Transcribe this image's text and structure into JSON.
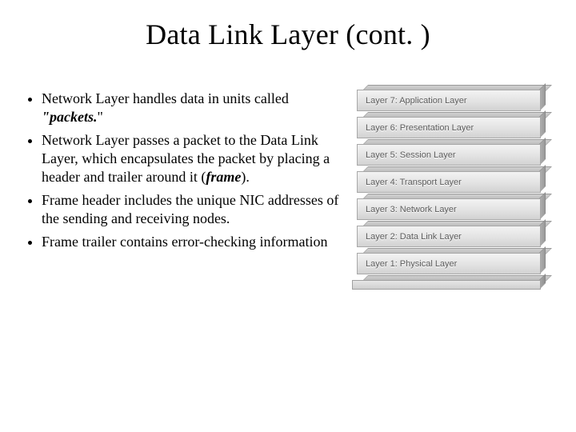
{
  "title": "Data Link Layer (cont. )",
  "bullets": [
    {
      "pre": "Network Layer handles data in units called ",
      "em": "\"packets.",
      "post": "\""
    },
    {
      "pre": "Network Layer passes a packet to the Data Link Layer, which encapsulates the packet by placing a header and trailer around it (",
      "em": "frame",
      "post": ")."
    },
    {
      "pre": "Frame header includes the unique NIC addresses of the sending and receiving nodes.",
      "em": "",
      "post": ""
    },
    {
      "pre": "Frame trailer contains error-checking information",
      "em": "",
      "post": ""
    }
  ],
  "osi_layers": [
    "Layer 7: Application Layer",
    "Layer 6: Presentation Layer",
    "Layer 5: Session Layer",
    "Layer 4: Transport Layer",
    "Layer 3: Network Layer",
    "Layer 2: Data Link Layer",
    "Layer 1: Physical Layer"
  ]
}
